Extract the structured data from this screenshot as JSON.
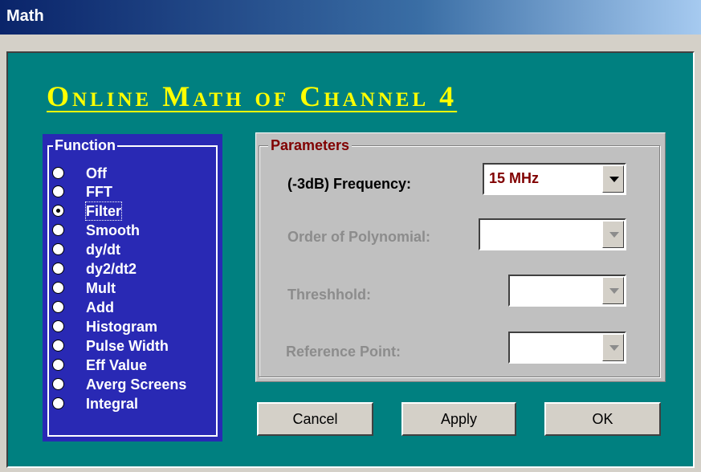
{
  "window": {
    "title": "Math"
  },
  "heading": "Online Math of Channel 4",
  "function_group": {
    "legend": "Function",
    "options": [
      {
        "label": "Off",
        "checked": false
      },
      {
        "label": "FFT",
        "checked": false
      },
      {
        "label": "Filter",
        "checked": true
      },
      {
        "label": "Smooth",
        "checked": false
      },
      {
        "label": "dy/dt",
        "checked": false
      },
      {
        "label": "dy2/dt2",
        "checked": false
      },
      {
        "label": "Mult",
        "checked": false
      },
      {
        "label": "Add",
        "checked": false
      },
      {
        "label": "Histogram",
        "checked": false
      },
      {
        "label": "Pulse Width",
        "checked": false
      },
      {
        "label": "Eff Value",
        "checked": false
      },
      {
        "label": "Averg Screens",
        "checked": false
      },
      {
        "label": "Integral",
        "checked": false
      }
    ]
  },
  "parameters": {
    "legend": "Parameters",
    "frequency": {
      "label": "(-3dB) Frequency:",
      "value": "15 MHz",
      "enabled": true
    },
    "order_of_polynomial": {
      "label": "Order of Polynomial:",
      "value": "",
      "enabled": false
    },
    "threshhold": {
      "label": "Threshhold:",
      "value": "",
      "enabled": false
    },
    "reference_point": {
      "label": "Reference Point:",
      "value": "",
      "enabled": false
    }
  },
  "buttons": {
    "cancel": "Cancel",
    "apply": "Apply",
    "ok": "OK"
  },
  "colors": {
    "client_bg": "#008080",
    "function_panel": "#2929b4",
    "heading": "#ffff00",
    "parameter_accent": "#800000"
  }
}
